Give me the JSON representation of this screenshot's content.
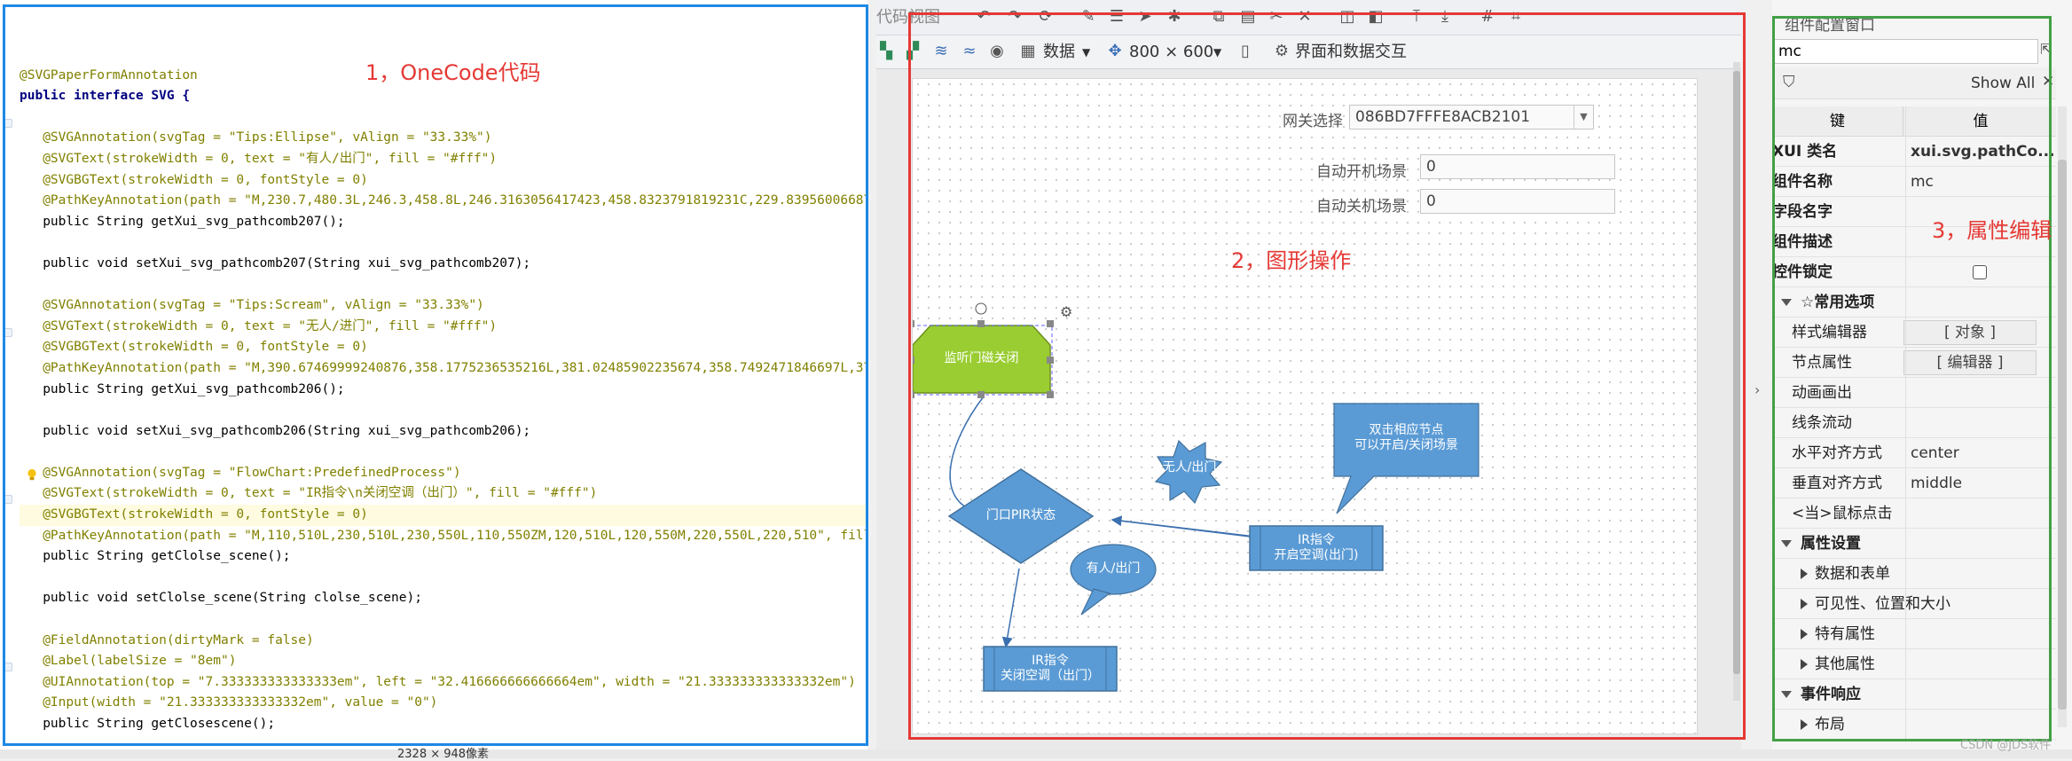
{
  "code_panel": {
    "title": "1，OneCode代码",
    "lines": [
      {
        "t": "",
        "c": "plain"
      },
      {
        "t": "@SVGPaperFormAnnotation",
        "c": "ann"
      },
      {
        "t": "public interface SVG {",
        "c": "kw"
      },
      {
        "t": "",
        "c": "plain"
      },
      {
        "t": "   @SVGAnnotation(svgTag = \"Tips:Ellipse\", vAlign = \"33.33%\")",
        "c": "ann"
      },
      {
        "t": "   @SVGText(strokeWidth = 0, text = \"有人/出门\", fill = \"#fff\")",
        "c": "ann"
      },
      {
        "t": "   @SVGBGText(strokeWidth = 0, fontStyle = 0)",
        "c": "ann"
      },
      {
        "t": "   @PathKeyAnnotation(path = \"M,230.7,480.3L,246.3,458.8L,246.3163056417423,458.8323791819231C,229.83956006687",
        "c": "ann"
      },
      {
        "t": "   public String getXui_svg_pathcomb207();",
        "c": "plain"
      },
      {
        "t": "",
        "c": "plain"
      },
      {
        "t": "   public void setXui_svg_pathcomb207(String xui_svg_pathcomb207);",
        "c": "plain"
      },
      {
        "t": "",
        "c": "plain"
      },
      {
        "t": "   @SVGAnnotation(svgTag = \"Tips:Scream\", vAlign = \"33.33%\")",
        "c": "ann"
      },
      {
        "t": "   @SVGText(strokeWidth = 0, text = \"无人/进门\", fill = \"#fff\")",
        "c": "ann"
      },
      {
        "t": "   @SVGBGText(strokeWidth = 0, fontStyle = 0)",
        "c": "ann"
      },
      {
        "t": "   @PathKeyAnnotation(path = \"M,390.67469999240876,358.1775236535216L,381.02485902235674,358.7492471846697L,37",
        "c": "ann"
      },
      {
        "t": "   public String getXui_svg_pathcomb206();",
        "c": "plain"
      },
      {
        "t": "",
        "c": "plain"
      },
      {
        "t": "   public void setXui_svg_pathcomb206(String xui_svg_pathcomb206);",
        "c": "plain"
      },
      {
        "t": "",
        "c": "plain"
      },
      {
        "t": "   @SVGAnnotation(svgTag = \"FlowChart:PredefinedProcess\")",
        "c": "ann"
      },
      {
        "t": "   @SVGText(strokeWidth = 0, text = \"IR指令\\n关闭空调（出门）\", fill = \"#fff\")",
        "c": "ann"
      },
      {
        "t": "   @SVGBGText(strokeWidth = 0, fontStyle = 0)",
        "c": "ann",
        "hl": true
      },
      {
        "t": "   @PathKeyAnnotation(path = \"M,110,510L,230,510L,230,550L,110,550ZM,120,510L,120,550M,220,550L,220,510\", fill",
        "c": "ann"
      },
      {
        "t": "   public String getClolse_scene();",
        "c": "plain"
      },
      {
        "t": "",
        "c": "plain"
      },
      {
        "t": "   public void setClolse_scene(String clolse_scene);",
        "c": "plain"
      },
      {
        "t": "",
        "c": "plain"
      },
      {
        "t": "   @FieldAnnotation(dirtyMark = false)",
        "c": "ann"
      },
      {
        "t": "   @Label(labelSize = \"8em\")",
        "c": "ann"
      },
      {
        "t": "   @UIAnnotation(top = \"7.333333333333333em\", left = \"32.416666666666664em\", width = \"21.333333333333332em\")",
        "c": "ann"
      },
      {
        "t": "   @Input(width = \"21.333333333333332em\", value = \"0\")",
        "c": "ann"
      },
      {
        "t": "   public String getClosescene();",
        "c": "plain"
      }
    ]
  },
  "designer": {
    "title": "2，图形操作",
    "toolbar1": {
      "tab_label": "代码视图"
    },
    "toolbar2": {
      "data_label": "数据",
      "size_label": "800 × 600",
      "interact_label": "界面和数据交互"
    },
    "form": {
      "gateway_label": "网关选择",
      "gateway_value": "086BD7FFFE8ACB2101",
      "auto_on_label": "自动开机场景",
      "auto_on_value": "0",
      "auto_off_label": "自动关机场景",
      "auto_off_value": "0"
    },
    "nodes": {
      "door_monitor": "监听门磁关闭",
      "pir_state": "门口PIR状态",
      "nobody_exit": "无人/出门",
      "someone_exit": "有人/出门",
      "ir_on_line1": "IR指令",
      "ir_on_line2": "开启空调(出门)",
      "ir_off_line1": "IR指令",
      "ir_off_line2": "关闭空调（出门）",
      "callout_line1": "双击相应节点",
      "callout_line2": "可以开启/关闭场景"
    },
    "colors": {
      "green_node": "#99cc33",
      "blue_node": "#5b9bd5",
      "dark_blue_border": "#41719c"
    }
  },
  "props_panel": {
    "title": "组件配置窗口",
    "section_label": "3，属性编辑",
    "search_value": "mc",
    "show_all_label": "Show All",
    "col_key": "键",
    "col_value": "值",
    "rows": {
      "xui_class_key": "XUI 类名",
      "xui_class_value": "xui.svg.pathCo...",
      "comp_name_key": "组件名称",
      "comp_name_value": "mc",
      "field_name_key": "字段名字",
      "comp_desc_key": "组件描述",
      "lock_key": "控件锁定",
      "common_section": "☆常用选项",
      "style_editor_key": "样式编辑器",
      "style_editor_value": "[ 对象 ]",
      "node_attr_key": "节点属性",
      "node_attr_value": "[ 编辑器 ]",
      "anim_key": "动画画出",
      "line_flow_key": "线条流动",
      "h_align_key": "水平对齐方式",
      "h_align_value": "center",
      "v_align_key": "垂直对齐方式",
      "v_align_value": "middle",
      "click_key": "<当>鼠标点击",
      "attr_section": "属性设置",
      "data_form": "数据和表单",
      "visibility": "可见性、位置和大小",
      "special": "特有属性",
      "other": "其他属性",
      "event_section": "事件响应",
      "layout": "布局"
    }
  },
  "statusbar": {
    "size_text": "2328 × 948像素",
    "watermark": "CSDN @JDS软件"
  }
}
